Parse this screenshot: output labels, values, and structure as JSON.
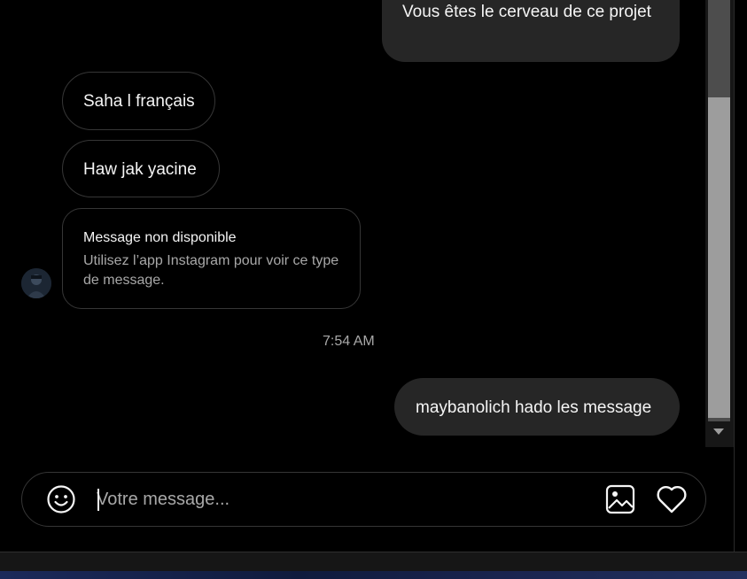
{
  "messages": {
    "top": "Vous êtes le cerveau de ce projet",
    "saha": "Saha l français",
    "haw": "Haw jak yacine",
    "unavailable": {
      "title": "Message non disponible",
      "body": "Utilisez l’app Instagram pour voir ce type de message."
    },
    "bottom": "maybanolich hado les message"
  },
  "timestamp": "7:54 AM",
  "composer": {
    "placeholder": "Votre message...",
    "value": "",
    "icons": [
      "smile-icon",
      "image-icon",
      "heart-icon"
    ]
  },
  "colors": {
    "background": "#000000",
    "outgoing_bubble": "#262626",
    "incoming_border": "#363636",
    "muted_text": "#a8a8a8",
    "text": "#f5f5f5"
  }
}
